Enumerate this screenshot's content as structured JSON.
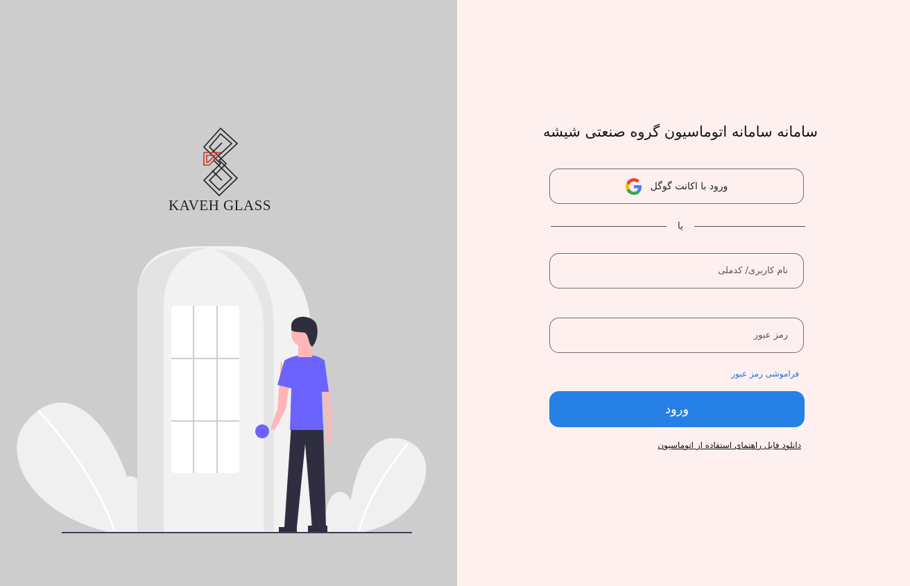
{
  "brand": {
    "logo_text": "KAVEH  GLASS"
  },
  "form": {
    "title": "سامانه سامانه اتوماسیون گروه صنعتی شیشه",
    "google_label": "ورود با اکانت گوگل",
    "google_icon": "google-icon",
    "divider_text": "یا",
    "username_placeholder": "نام کاربری/ کدملی",
    "password_placeholder": "رمز عبور",
    "forgot_label": "فراموشی رمز عبور",
    "login_label": "ورود",
    "download_label": "دانلود فایل راهنمای استفاده از اتوماسیون"
  },
  "colors": {
    "left_bg": "#cdcdcd",
    "right_bg": "#fff0f0",
    "accent": "#2680e5",
    "person_shirt": "#6c63ff",
    "person_pants": "#2f2e41",
    "skin": "#ffb6b6"
  }
}
